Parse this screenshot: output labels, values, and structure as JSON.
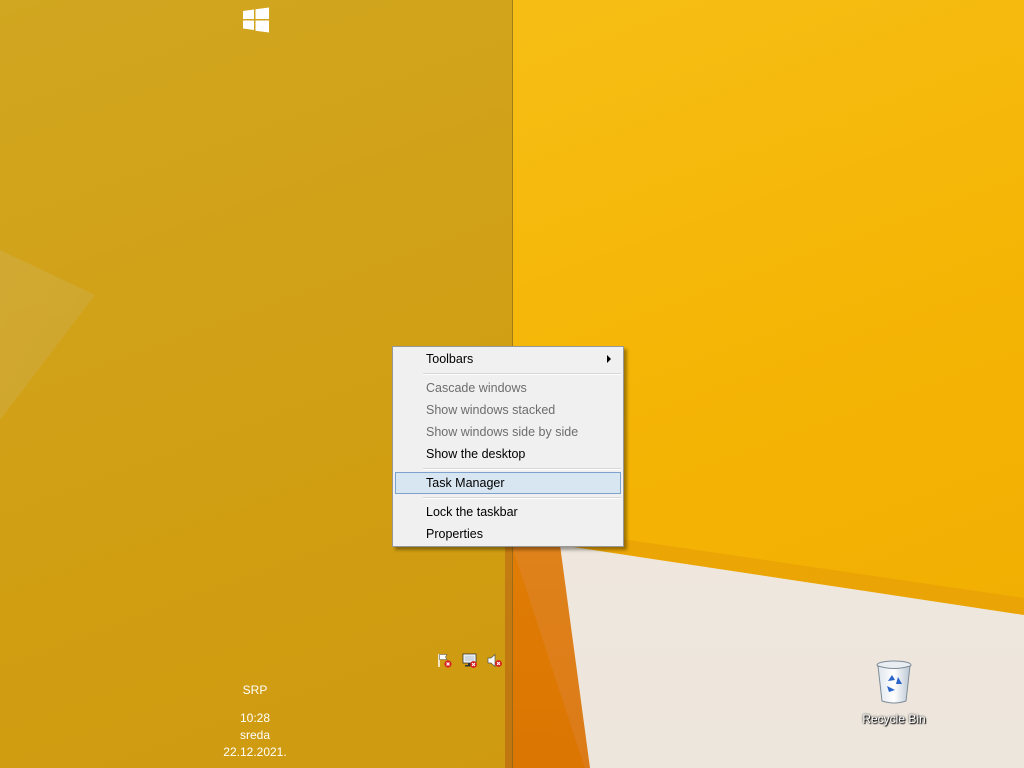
{
  "start": {
    "icon": "windows-logo-icon"
  },
  "context_menu": {
    "items": [
      {
        "label": "Toolbars",
        "has_submenu": true,
        "enabled": true
      },
      {
        "label": "Cascade windows",
        "enabled": false
      },
      {
        "label": "Show windows stacked",
        "enabled": false
      },
      {
        "label": "Show windows side by side",
        "enabled": false
      },
      {
        "label": "Show the desktop",
        "enabled": true
      },
      {
        "label": "Task Manager",
        "enabled": true,
        "highlighted": true
      },
      {
        "label": "Lock the taskbar",
        "enabled": true
      },
      {
        "label": "Properties",
        "enabled": true
      }
    ]
  },
  "tray": {
    "icons": [
      "action-center-flag-icon",
      "network-disconnected-icon",
      "volume-muted-icon"
    ],
    "language": "SRP",
    "time": "10:28",
    "day": "sreda",
    "date": "22.12.2021."
  },
  "desktop": {
    "icons": [
      {
        "label": "Recycle Bin",
        "icon": "recycle-bin-icon"
      }
    ]
  },
  "colors": {
    "wallpaper_yellow": "#f7b90a",
    "menu_bg": "#f0f0f0",
    "menu_highlight": "#d8e6f2",
    "menu_highlight_border": "#7da2ce"
  }
}
